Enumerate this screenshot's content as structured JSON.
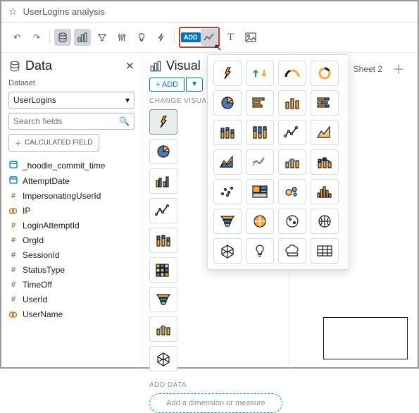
{
  "header": {
    "title": "UserLogins analysis"
  },
  "toolbar": {
    "add_badge": "ADD"
  },
  "data_panel": {
    "title": "Data",
    "dataset_label": "Dataset",
    "dataset_value": "UserLogins",
    "search_placeholder": "Search fields",
    "calc_button": "CALCULATED FIELD",
    "fields": [
      {
        "icon": "date",
        "label": "_hoodie_commit_time"
      },
      {
        "icon": "date",
        "label": "AttemptDate"
      },
      {
        "icon": "num",
        "label": "ImpersonatingUserId"
      },
      {
        "icon": "str",
        "label": "IP"
      },
      {
        "icon": "num",
        "label": "LoginAttemptId"
      },
      {
        "icon": "num",
        "label": "OrgId"
      },
      {
        "icon": "num",
        "label": "SessionId"
      },
      {
        "icon": "num",
        "label": "StatusType"
      },
      {
        "icon": "num",
        "label": "TimeOff"
      },
      {
        "icon": "num",
        "label": "UserId"
      },
      {
        "icon": "str",
        "label": "UserName"
      }
    ]
  },
  "visual_panel": {
    "title": "Visual",
    "add_button": "+ ADD",
    "change_label": "CHANGE VISUA",
    "tiles": [
      "autograph",
      "pie",
      "clustered-bar",
      "line",
      "stacked-bar",
      "heatmap",
      "funnel",
      "combo",
      "polygon"
    ],
    "add_data_label": "ADD DATA",
    "drop_hint": "Add a dimension or measure"
  },
  "popup": {
    "tiles": [
      "autograph",
      "kpi-updown",
      "gauge",
      "donut",
      "pie",
      "horizontal-bar",
      "vertical-bar",
      "stacked-bar-h",
      "stacked-bar-v",
      "stacked-100",
      "line",
      "area",
      "area-stacked",
      "multi-line",
      "combo",
      "combo-stacked",
      "scatter",
      "treemap",
      "bubble",
      "histogram",
      "funnel",
      "globe-filled",
      "globe-points",
      "globe",
      "geospatial",
      "insight",
      "word-cloud",
      "table"
    ]
  },
  "sheets": {
    "tabs": [
      "Sheet 2"
    ]
  }
}
